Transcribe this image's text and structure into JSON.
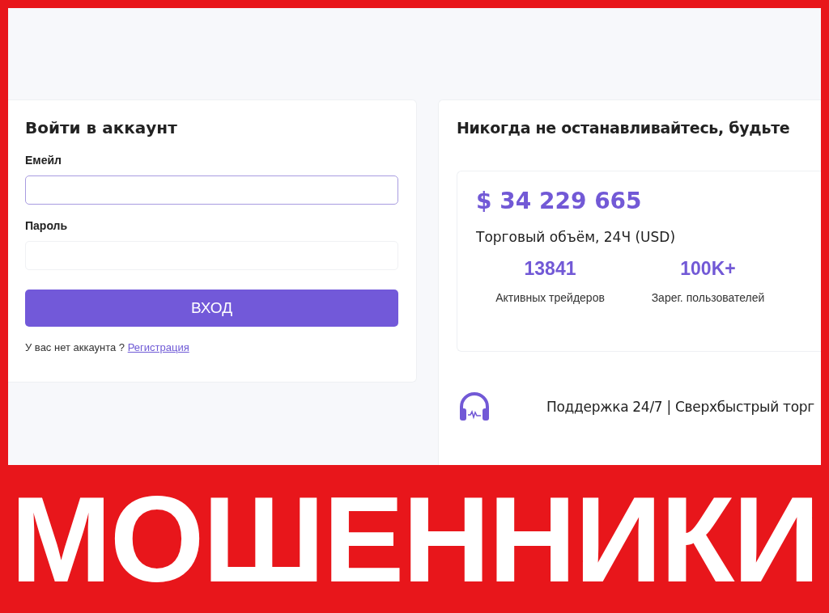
{
  "login": {
    "title": "Войти в аккаунт",
    "fields": [
      {
        "label": "Емейл",
        "focused": true
      },
      {
        "label": "Пароль",
        "focused": false
      }
    ],
    "button": "ВХОД",
    "prompt": "У вас нет аккаунта ?",
    "link": "Регистрация"
  },
  "promo": {
    "headline": "Никогда не останавливайтесь, будьте",
    "volume": "$ 34 229 665",
    "volume_label": "Торговый объём, 24Ч (USD)",
    "stats": [
      {
        "value": "13841",
        "label": "Активных трейдеров"
      },
      {
        "value": "100K+",
        "label": "Зарег. пользователей"
      }
    ],
    "support": "Поддержка 24/7 | Сверхбыстрый торг"
  },
  "banner": {
    "text": "МОШЕННИКИ"
  }
}
